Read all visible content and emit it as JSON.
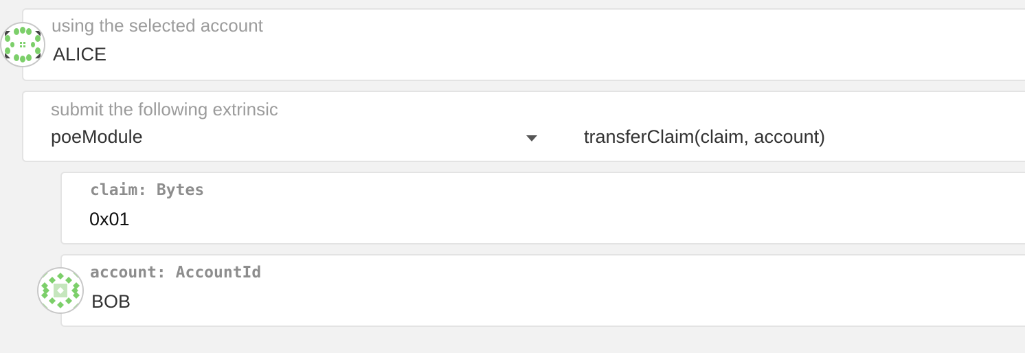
{
  "account_section": {
    "label": "using the selected account",
    "value": "ALICE",
    "icon": "identicon-alice"
  },
  "extrinsic_section": {
    "label": "submit the following extrinsic",
    "module": "poeModule",
    "method": "transferClaim(claim, account)",
    "icon": "chevron-down-icon"
  },
  "params": [
    {
      "label": "claim: Bytes",
      "value": "0x01"
    },
    {
      "label": "account: AccountId",
      "value": "BOB",
      "icon": "identicon-bob"
    }
  ],
  "colors": {
    "background": "#f2f2f2",
    "card": "#ffffff",
    "border": "#e3e3e3",
    "identicon_green": "#7ccf6a",
    "label_text": "#9c9c9c"
  }
}
